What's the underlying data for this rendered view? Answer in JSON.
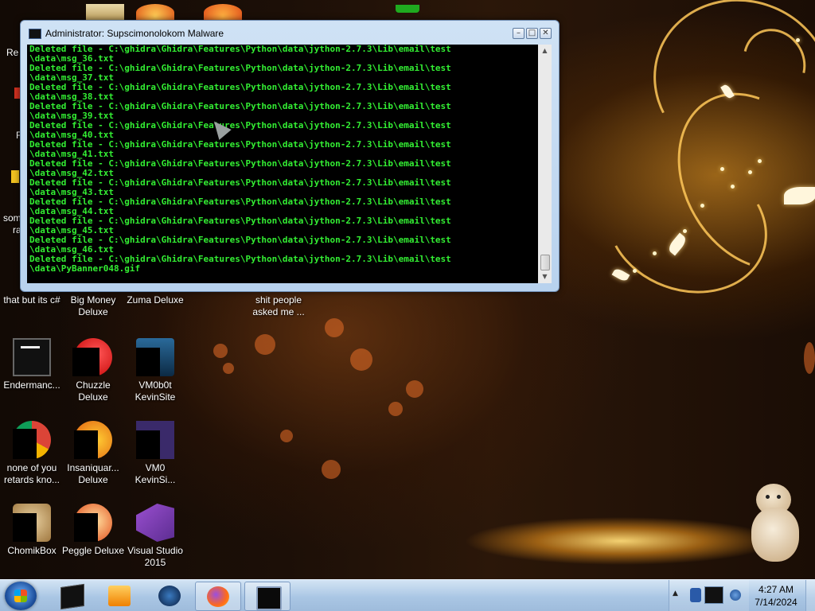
{
  "console": {
    "title": "Administrator:  Supscimonolokom Malware",
    "lines": [
      "Deleted file - C:\\ghidra\\Ghidra\\Features\\Python\\data\\jython-2.7.3\\Lib\\email\\test",
      "\\data\\msg_36.txt",
      "Deleted file - C:\\ghidra\\Ghidra\\Features\\Python\\data\\jython-2.7.3\\Lib\\email\\test",
      "\\data\\msg_37.txt",
      "Deleted file - C:\\ghidra\\Ghidra\\Features\\Python\\data\\jython-2.7.3\\Lib\\email\\test",
      "\\data\\msg_38.txt",
      "Deleted file - C:\\ghidra\\Ghidra\\Features\\Python\\data\\jython-2.7.3\\Lib\\email\\test",
      "\\data\\msg_39.txt",
      "Deleted file - C:\\ghidra\\Ghidra\\Features\\Python\\data\\jython-2.7.3\\Lib\\email\\test",
      "\\data\\msg_40.txt",
      "Deleted file - C:\\ghidra\\Ghidra\\Features\\Python\\data\\jython-2.7.3\\Lib\\email\\test",
      "\\data\\msg_41.txt",
      "Deleted file - C:\\ghidra\\Ghidra\\Features\\Python\\data\\jython-2.7.3\\Lib\\email\\test",
      "\\data\\msg_42.txt",
      "Deleted file - C:\\ghidra\\Ghidra\\Features\\Python\\data\\jython-2.7.3\\Lib\\email\\test",
      "\\data\\msg_43.txt",
      "Deleted file - C:\\ghidra\\Ghidra\\Features\\Python\\data\\jython-2.7.3\\Lib\\email\\test",
      "\\data\\msg_44.txt",
      "Deleted file - C:\\ghidra\\Ghidra\\Features\\Python\\data\\jython-2.7.3\\Lib\\email\\test",
      "\\data\\msg_45.txt",
      "Deleted file - C:\\ghidra\\Ghidra\\Features\\Python\\data\\jython-2.7.3\\Lib\\email\\test",
      "\\data\\msg_46.txt",
      "Deleted file - C:\\ghidra\\Ghidra\\Features\\Python\\data\\jython-2.7.3\\Lib\\email\\test",
      "\\data\\PyBanner048.gif"
    ],
    "text_color": "#33ee33",
    "controls": {
      "minimize": "–",
      "maximize": "□",
      "close": "✕"
    }
  },
  "desktop_icons": {
    "recycle_partial": "Re",
    "partial_f": "F",
    "partial_som": "som",
    "partial_ra": "ra",
    "that_but_its_c": "that but its c#",
    "big_money_1": "Big Money",
    "big_money_2": "Deluxe",
    "zuma": "Zuma Deluxe",
    "shit_people_1": "shit people",
    "shit_people_2": "asked me ...",
    "endermanch": "Endermanc...",
    "chuzzle_1": "Chuzzle",
    "chuzzle_2": "Deluxe",
    "vm0b0t_1": "VM0b0t",
    "vm0b0t_2": "KevinSite",
    "none_of_you_1": "none of you",
    "none_of_you_2": "retards kno...",
    "insaniquarium_1": "Insaniquar...",
    "insaniquarium_2": "Deluxe",
    "vm0_1": "VM0",
    "vm0_2": "KevinSi...",
    "chomikbox": "ChomikBox",
    "peggle": "Peggle Deluxe",
    "visual_studio_1": "Visual Studio",
    "visual_studio_2": "2015"
  },
  "taskbar": {
    "pinned": [
      "console-icon",
      "media-player-icon",
      "vm-globe-icon",
      "firefox-icon",
      "console-active-icon"
    ],
    "clock_time": "4:27 AM",
    "clock_date": "7/14/2024"
  }
}
